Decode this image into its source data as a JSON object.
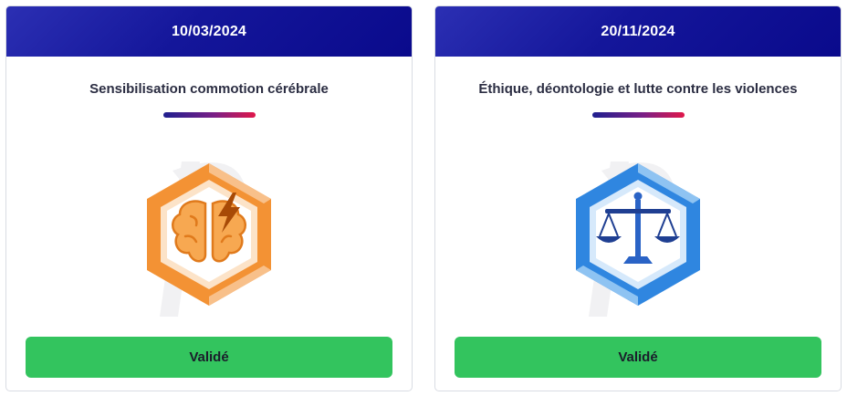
{
  "cards": [
    {
      "date": "10/03/2024",
      "title": "Sensibilisation commotion cérébrale",
      "badge_icon": "brain-lightning-icon",
      "badge_color": "#f39234",
      "button_label": "Validé"
    },
    {
      "date": "20/11/2024",
      "title": "Éthique, déontologie et lutte contre les violences",
      "badge_icon": "scales-icon",
      "badge_color": "#2f86e0",
      "button_label": "Validé"
    }
  ],
  "colors": {
    "header": "#14169a",
    "accent_start": "#1f1f8f",
    "accent_end": "#e0174a",
    "button": "#33c45e"
  }
}
